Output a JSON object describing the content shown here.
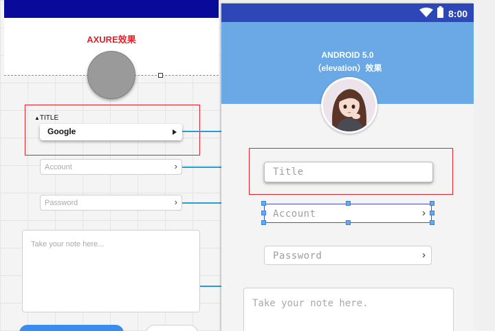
{
  "axure": {
    "title": "AXURE效果",
    "title_section_label": "TITLE",
    "dropdown_value": "Google",
    "account_placeholder": "Account",
    "password_placeholder": "Password",
    "note_placeholder": "Take your note here..."
  },
  "android": {
    "status_time": "8:00",
    "title": "ANDROID 5.0",
    "subtitle": "（elevation）效果",
    "title_placeholder": "Title",
    "account_placeholder": "Account",
    "password_placeholder": "Password",
    "note_placeholder": "Take your note here."
  },
  "colors": {
    "axure_topbar": "#0a0a9a",
    "annotation_red": "#e4202a",
    "status_bar": "#2e47b8",
    "app_bar": "#6aa9e6",
    "connector": "#2a9bd6",
    "primary_button": "#3a8df0"
  },
  "chevron": "›",
  "triangle_up": "▲"
}
